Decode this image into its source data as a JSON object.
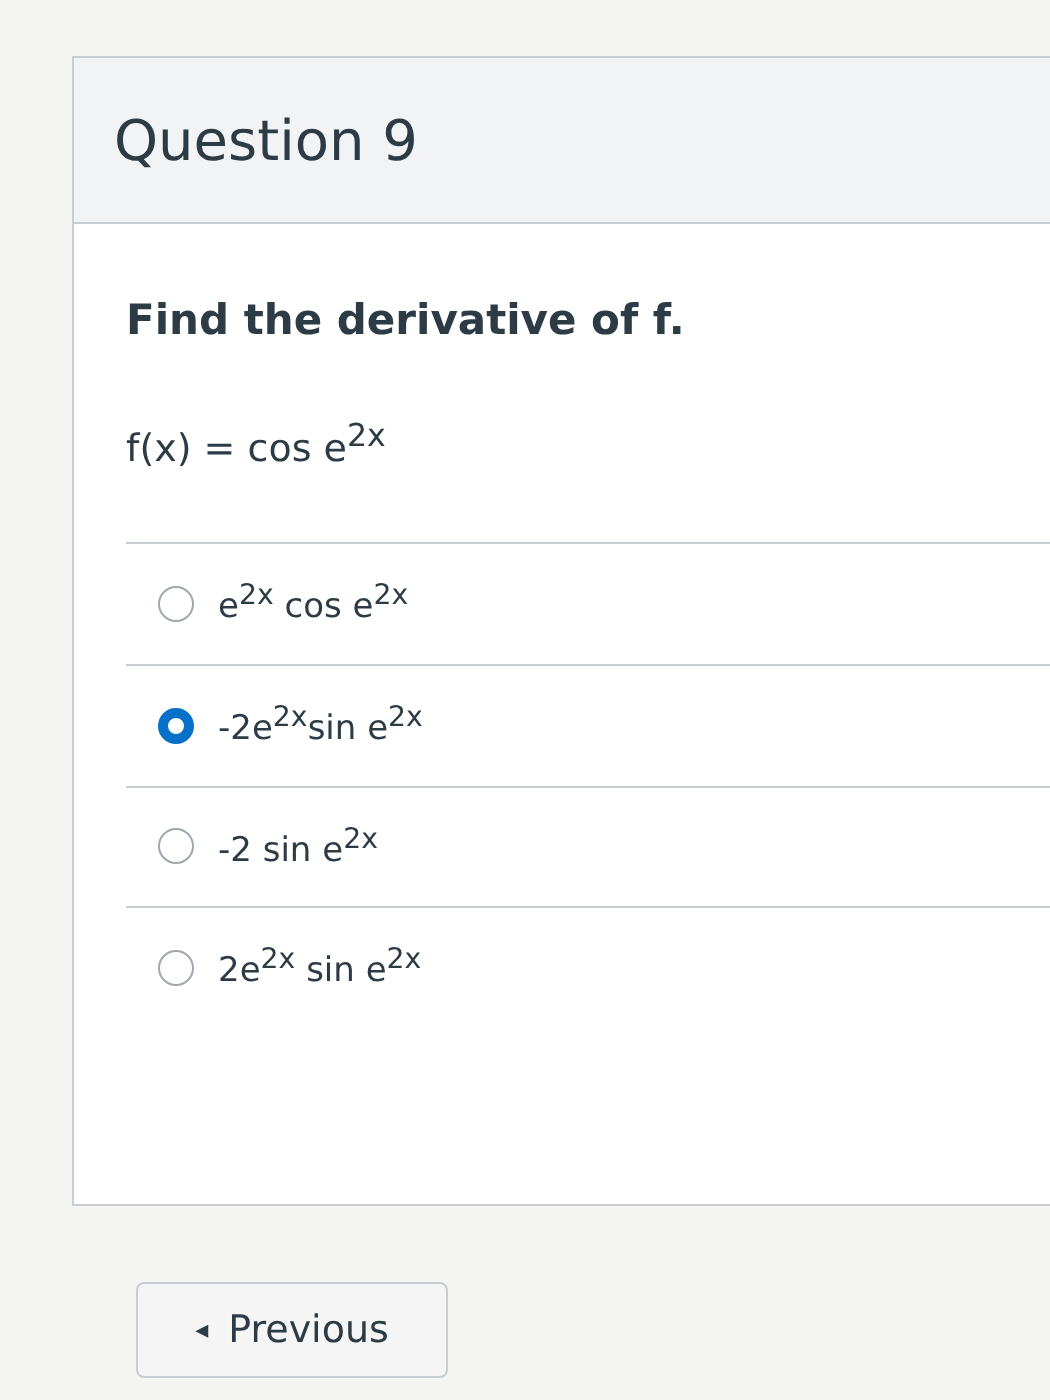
{
  "question": {
    "title": "Question 9",
    "prompt": "Find the derivative of f.",
    "function": "f(x) = cos e$^{2x}$",
    "options": [
      {
        "label": "e$^{2x}$ cos e$^{2x}$",
        "selected": false
      },
      {
        "label": "-2e$^{2x}$sin e$^{2x}$",
        "selected": true
      },
      {
        "label": "-2 sin e$^{2x}$",
        "selected": false
      },
      {
        "label": "2e$^{2x}$ sin e$^{2x}$",
        "selected": false
      }
    ]
  },
  "navigation": {
    "previous": {
      "icon": "◂",
      "label": "Previous"
    }
  }
}
